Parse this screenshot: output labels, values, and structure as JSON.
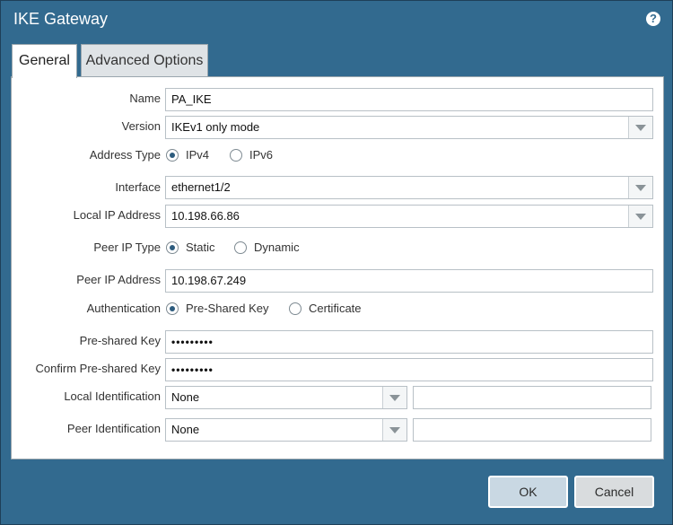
{
  "dialog": {
    "title": "IKE Gateway"
  },
  "tabs": [
    {
      "label": "General",
      "active": true
    },
    {
      "label": "Advanced Options",
      "active": false
    }
  ],
  "form": {
    "name": {
      "label": "Name",
      "value": "PA_IKE"
    },
    "version": {
      "label": "Version",
      "value": "IKEv1 only mode"
    },
    "address_type": {
      "label": "Address Type",
      "options": [
        "IPv4",
        "IPv6"
      ],
      "selected": "IPv4"
    },
    "interface": {
      "label": "Interface",
      "value": "ethernet1/2"
    },
    "local_ip": {
      "label": "Local IP Address",
      "value": "10.198.66.86"
    },
    "peer_ip_type": {
      "label": "Peer IP Type",
      "options": [
        "Static",
        "Dynamic"
      ],
      "selected": "Static"
    },
    "peer_ip": {
      "label": "Peer IP Address",
      "value": "10.198.67.249"
    },
    "authentication": {
      "label": "Authentication",
      "options": [
        "Pre-Shared Key",
        "Certificate"
      ],
      "selected": "Pre-Shared Key"
    },
    "psk": {
      "label": "Pre-shared Key",
      "value": "•••••••••"
    },
    "psk_confirm": {
      "label": "Confirm Pre-shared Key",
      "value": "•••••••••"
    },
    "local_id": {
      "label": "Local Identification",
      "value": "None",
      "extra": ""
    },
    "peer_id": {
      "label": "Peer Identification",
      "value": "None",
      "extra": ""
    }
  },
  "buttons": {
    "ok": "OK",
    "cancel": "Cancel"
  },
  "colors": {
    "header": "#326a8f",
    "panel": "#ffffff",
    "ok_button": "#c9d8e3"
  }
}
